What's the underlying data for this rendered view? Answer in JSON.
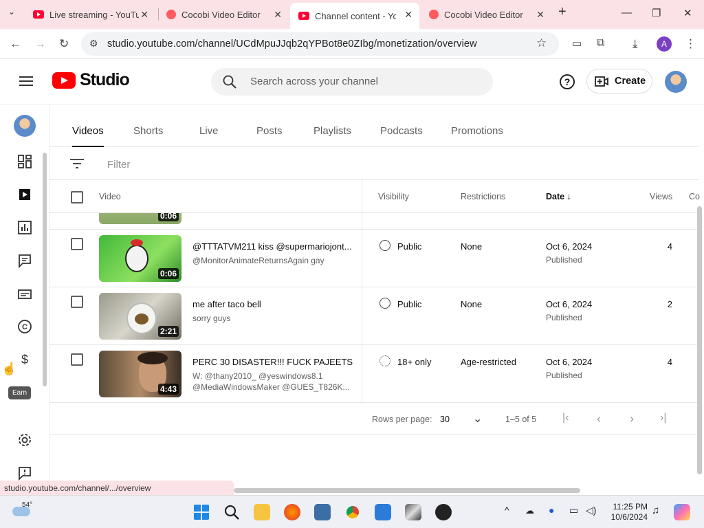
{
  "browser": {
    "tabs": [
      {
        "label": "Live streaming - YouTube",
        "icon": "youtube-icon"
      },
      {
        "label": "Cocobi Video Editor",
        "icon": "cocobi-icon"
      },
      {
        "label": "Channel content - YouTube",
        "icon": "youtube-icon",
        "active": true
      },
      {
        "label": "Cocobi Video Editor",
        "icon": "cocobi-icon"
      }
    ],
    "new_tab": "+",
    "url": "studio.youtube.com/channel/UCdMpuJJqb2qYPBot8e0ZIbg/monetization/overview",
    "profile_letter": "A"
  },
  "header": {
    "brand": "Studio",
    "search_placeholder": "Search across your channel",
    "help": "?",
    "create_label": "Create"
  },
  "sidebar": {
    "items": [
      "dashboard",
      "content",
      "analytics",
      "comments",
      "subtitles",
      "copyright",
      "earn",
      "settings",
      "feedback"
    ],
    "earn_tooltip": "Earn"
  },
  "content_tabs": [
    "Videos",
    "Shorts",
    "Live",
    "Posts",
    "Playlists",
    "Podcasts",
    "Promotions"
  ],
  "filter_placeholder": "Filter",
  "table": {
    "headers": {
      "video": "Video",
      "visibility": "Visibility",
      "restrictions": "Restrictions",
      "date": "Date",
      "views": "Views",
      "comments": "Co"
    },
    "partial_duration": "0:06",
    "rows": [
      {
        "title": "@TTTATVM211 kiss @supermariojont...",
        "desc": "@MonitorAnimateReturnsAgain gay",
        "duration": "0:06",
        "visibility": "Public",
        "restrictions": "None",
        "date": "Oct 6, 2024",
        "status": "Published",
        "views": "4"
      },
      {
        "title": "me after taco bell",
        "desc": "sorry guys",
        "duration": "2:21",
        "visibility": "Public",
        "restrictions": "None",
        "date": "Oct 6, 2024",
        "status": "Published",
        "views": "2"
      },
      {
        "title": "PERC 30 DISASTER!!! FUCK PAJEETS",
        "desc": "W: @thany2010_ @yeswindows8.1 @MediaWindowsMaker @GUES_T826K...",
        "duration": "4:43",
        "visibility": "18+ only",
        "restrictions": "Age-restricted",
        "date": "Oct 6, 2024",
        "status": "Published",
        "views": "4"
      }
    ]
  },
  "pager": {
    "rows_label": "Rows per page:",
    "rows_value": "30",
    "range": "1–5 of 5"
  },
  "status_url": "studio.youtube.com/channel/.../overview",
  "taskbar": {
    "temp": "54°",
    "time": "11:25 PM",
    "date": "10/6/2024"
  }
}
